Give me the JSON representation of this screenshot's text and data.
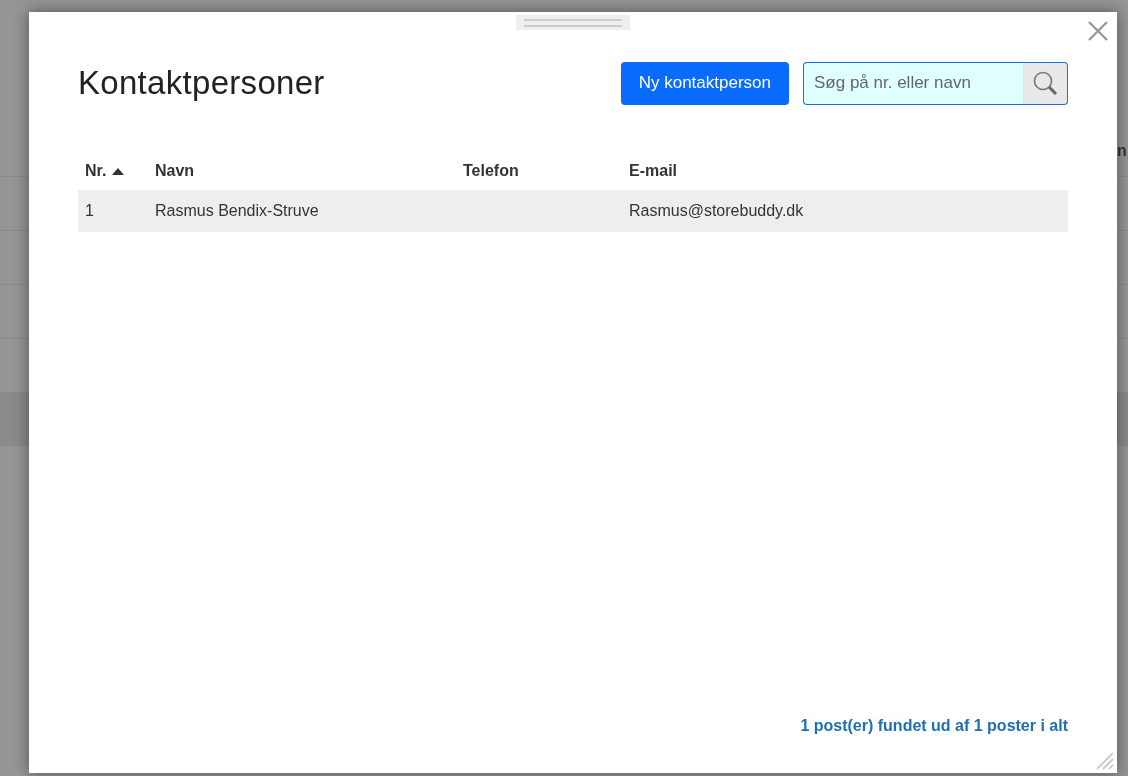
{
  "background": {
    "column_header": "n"
  },
  "dialog": {
    "title": "Kontaktpersoner",
    "new_button": "Ny kontaktperson",
    "search": {
      "placeholder": "Søg på nr. eller navn"
    },
    "table": {
      "columns": [
        {
          "label": "Nr.",
          "sorted": true
        },
        {
          "label": "Navn",
          "sorted": false
        },
        {
          "label": "Telefon",
          "sorted": false
        },
        {
          "label": "E-mail",
          "sorted": false
        }
      ],
      "rows": [
        [
          "1",
          "Rasmus Bendix-Struve",
          "",
          "Rasmus@storebuddy.dk"
        ]
      ]
    },
    "footer": "1 post(er) fundet ud af 1 poster i alt"
  }
}
